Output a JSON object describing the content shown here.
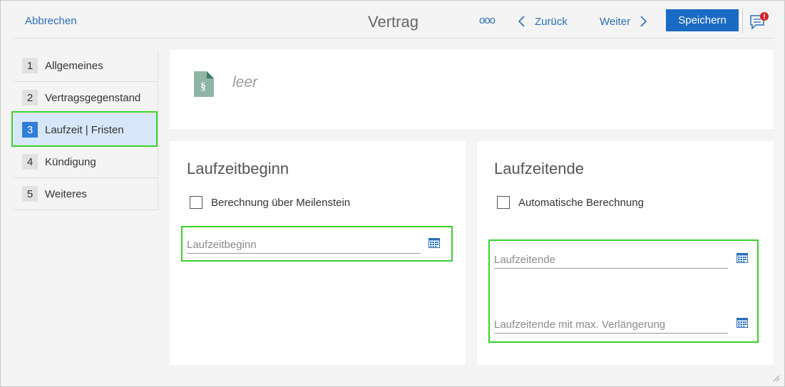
{
  "header": {
    "cancel_label": "Abbrechen",
    "title": "Vertrag",
    "more_label": "ooo",
    "back_label": "Zurück",
    "next_label": "Weiter",
    "save_label": "Speichern",
    "accent_color": "#1b6ac3"
  },
  "sidebar": {
    "items": [
      {
        "num": "1",
        "label": "Allgemeines",
        "active": false
      },
      {
        "num": "2",
        "label": "Vertragsgegenstand",
        "active": false
      },
      {
        "num": "3",
        "label": "Laufzeit | Fristen",
        "active": true
      },
      {
        "num": "4",
        "label": "Kündigung",
        "active": false
      },
      {
        "num": "5",
        "label": "Weiteres",
        "active": false
      }
    ]
  },
  "document": {
    "icon": "contract-document-icon",
    "empty_text": "leer"
  },
  "start": {
    "title": "Laufzeitbeginn",
    "checkbox_label": "Berechnung über Meilenstein",
    "field_placeholder": "Laufzeitbeginn"
  },
  "end": {
    "title": "Laufzeitende",
    "checkbox_label": "Automatische Berechnung",
    "field_placeholder": "Laufzeitende",
    "max_field_placeholder": "Laufzeitende mit max. Verlängerung"
  },
  "colors": {
    "highlight": "#37d12c",
    "link": "#2a6ebb",
    "active_step_bg": "#d7e7f9",
    "active_step_num": "#2f7ed8"
  }
}
